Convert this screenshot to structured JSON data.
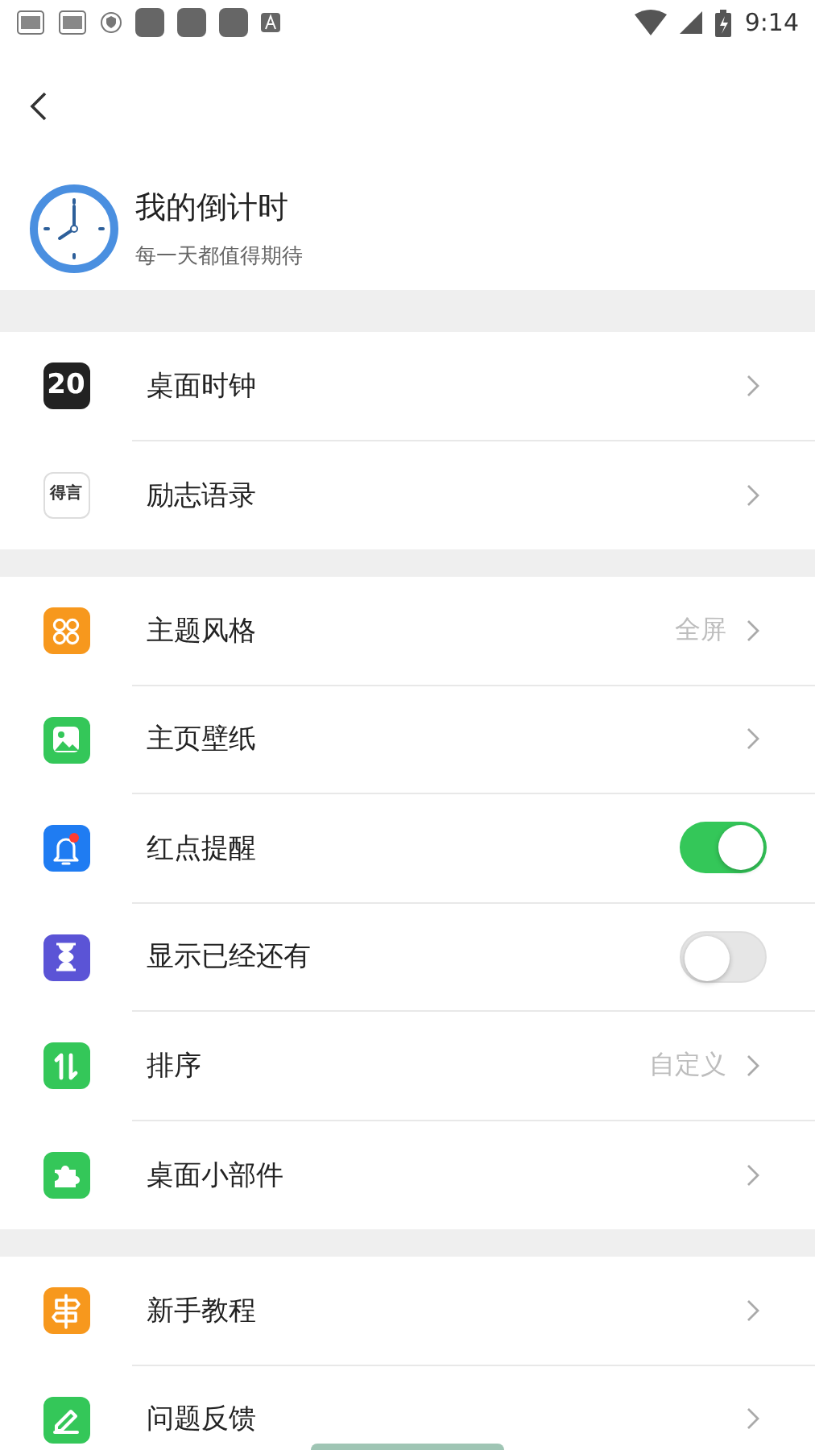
{
  "status_bar": {
    "time": "9:14"
  },
  "header": {
    "title": "我的倒计时",
    "subtitle": "每一天都值得期待"
  },
  "sections": [
    {
      "items": [
        {
          "label": "桌面时钟",
          "kind": "link",
          "icon_text": "20",
          "color": "#222222"
        },
        {
          "label": "励志语录",
          "kind": "link",
          "icon_text": "得言"
        }
      ]
    },
    {
      "items": [
        {
          "label": "主题风格",
          "kind": "link",
          "value": "全屏",
          "color": "#f7981d"
        },
        {
          "label": "主页壁纸",
          "kind": "link",
          "color": "#34c759"
        },
        {
          "label": "红点提醒",
          "kind": "toggle",
          "on": true,
          "color": "#1f7cf2"
        },
        {
          "label": "显示已经还有",
          "kind": "toggle",
          "on": false,
          "color": "#5b54d6"
        },
        {
          "label": "排序",
          "kind": "link",
          "value": "自定义",
          "color": "#34c759"
        },
        {
          "label": "桌面小部件",
          "kind": "link",
          "color": "#34c759"
        }
      ]
    },
    {
      "items": [
        {
          "label": "新手教程",
          "kind": "link",
          "color": "#f7981d"
        },
        {
          "label": "问题反馈",
          "kind": "link",
          "color": "#34c759"
        }
      ]
    }
  ]
}
